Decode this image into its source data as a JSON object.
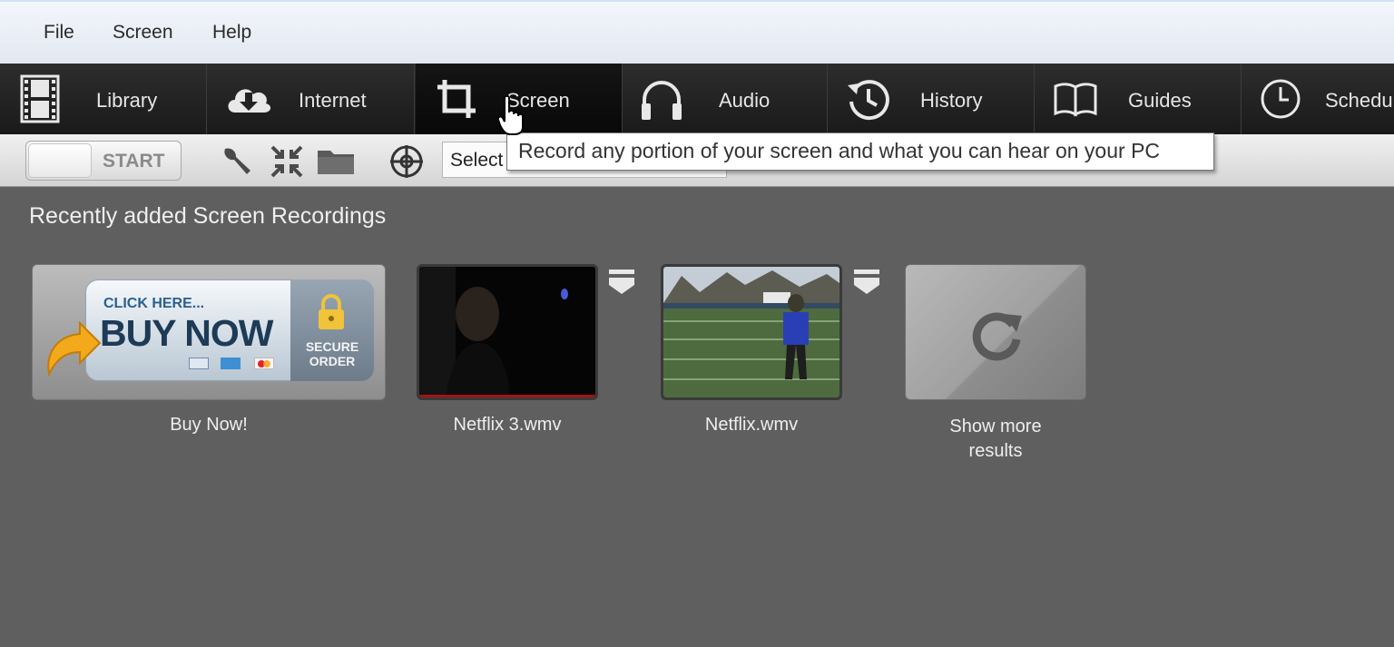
{
  "menu": {
    "file": "File",
    "screen": "Screen",
    "help": "Help"
  },
  "nav": {
    "library": "Library",
    "internet": "Internet",
    "screen": "Screen",
    "audio": "Audio",
    "history": "History",
    "guides": "Guides",
    "schedule": "Schedu"
  },
  "toolbar": {
    "toggle_label": "START",
    "select_value": "Select"
  },
  "tooltip": "Record any portion of your screen and what you can hear on your PC",
  "section_title": "Recently added Screen Recordings",
  "buy": {
    "click_here": "CLICK HERE...",
    "buy_now": "BUY NOW",
    "secure_line1": "SECURE",
    "secure_line2": "ORDER",
    "caption": "Buy Now!"
  },
  "recordings": [
    {
      "caption": "Netflix 3.wmv"
    },
    {
      "caption": "Netflix.wmv"
    }
  ],
  "more": {
    "line1": "Show more",
    "line2": "results"
  },
  "icons": [
    "film-icon",
    "cloud-download-icon",
    "crop-icon",
    "headphones-icon",
    "history-icon",
    "book-icon",
    "clock-icon",
    "wrench-icon",
    "collapse-icon",
    "folder-icon",
    "target-icon",
    "lock-icon",
    "refresh-icon",
    "hand-cursor-icon"
  ]
}
